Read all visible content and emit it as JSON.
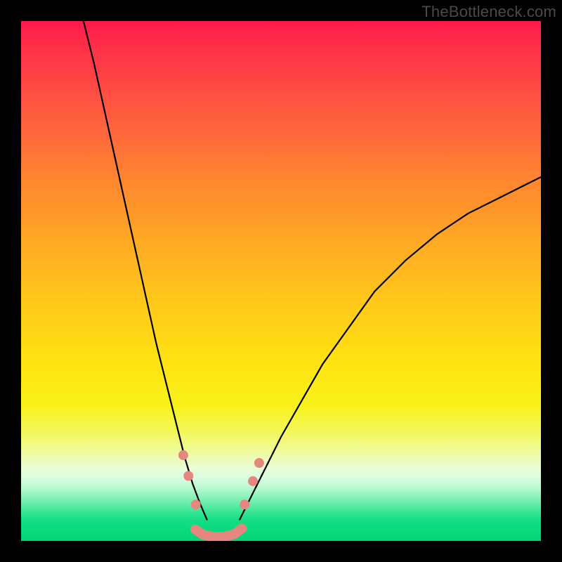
{
  "watermark": {
    "text": "TheBottleneck.com"
  },
  "chart_data": {
    "type": "line",
    "title": "",
    "xlabel": "",
    "ylabel": "",
    "xlim": [
      0,
      100
    ],
    "ylim": [
      0,
      100
    ],
    "grid": false,
    "legend": false,
    "background_gradient": {
      "orientation": "vertical",
      "stops": [
        {
          "pos": 0.0,
          "color": "#ff1a4a"
        },
        {
          "pos": 0.3,
          "color": "#ff8430"
        },
        {
          "pos": 0.6,
          "color": "#ffd61a"
        },
        {
          "pos": 0.8,
          "color": "#f3f85a"
        },
        {
          "pos": 0.9,
          "color": "#9af5c0"
        },
        {
          "pos": 1.0,
          "color": "#00d477"
        }
      ]
    },
    "series": [
      {
        "name": "left-branch",
        "color": "#000000",
        "width": 2.2,
        "x": [
          12,
          14,
          16,
          18,
          20,
          22,
          24,
          26,
          28,
          30,
          31.5,
          33,
          34.5,
          35.8
        ],
        "y": [
          100,
          92,
          83,
          74,
          65,
          56,
          47,
          38,
          30,
          22,
          16,
          11,
          7,
          4
        ]
      },
      {
        "name": "right-branch",
        "color": "#000000",
        "width": 2.2,
        "x": [
          42,
          44,
          47,
          50,
          54,
          58,
          63,
          68,
          74,
          80,
          86,
          92,
          98,
          100
        ],
        "y": [
          4,
          8,
          14,
          20,
          27,
          34,
          41,
          48,
          54,
          59,
          63,
          66,
          69,
          70
        ]
      },
      {
        "name": "valley-floor",
        "color": "#e4877f",
        "width": 14,
        "linecap": "round",
        "x": [
          33.5,
          35,
          37,
          39,
          41,
          42.5
        ],
        "y": [
          2.2,
          1.2,
          0.8,
          0.8,
          1.3,
          2.4
        ]
      }
    ],
    "markers": [
      {
        "series": "left-dots",
        "color": "#e4877f",
        "r": 7,
        "points": [
          {
            "x": 31.2,
            "y": 16.5
          },
          {
            "x": 32.2,
            "y": 12.5
          },
          {
            "x": 33.6,
            "y": 7.0
          }
        ]
      },
      {
        "series": "right-dots",
        "color": "#e4877f",
        "r": 7,
        "points": [
          {
            "x": 43.0,
            "y": 7.0
          },
          {
            "x": 44.6,
            "y": 11.5
          },
          {
            "x": 45.8,
            "y": 15.0
          }
        ]
      }
    ]
  }
}
